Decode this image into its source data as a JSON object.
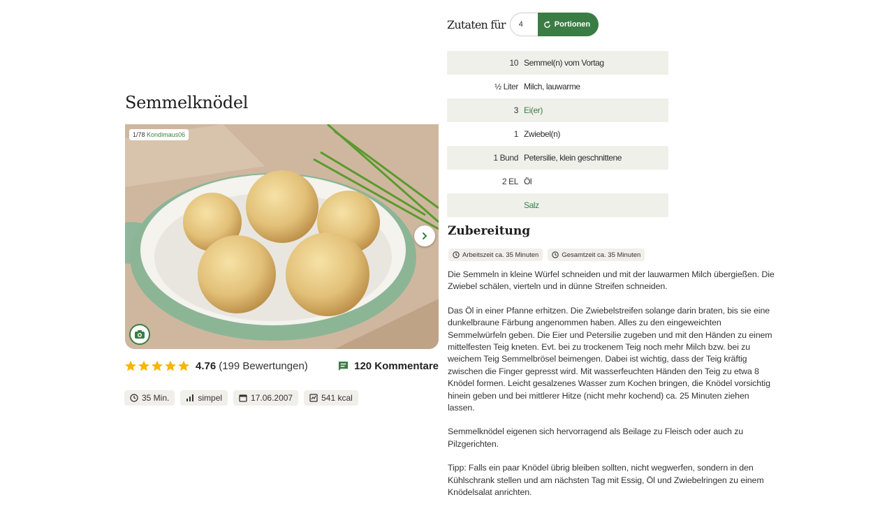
{
  "recipe": {
    "title": "Semmelknödel",
    "image_counter": "1/78",
    "image_author": "Kondimaus06",
    "rating_value": "4.76",
    "rating_count": "(199 Bewertungen)",
    "rating_stars": 5,
    "comments": "120 Kommentare",
    "meta": [
      {
        "icon": "clock-icon",
        "text": "35 Min."
      },
      {
        "icon": "difficulty-icon",
        "text": "simpel"
      },
      {
        "icon": "calendar-icon",
        "text": "17.06.2007"
      },
      {
        "icon": "nutrition-icon",
        "text": "541 kcal"
      }
    ]
  },
  "ingredients": {
    "label": "Zutaten für",
    "portions_value": "4",
    "portions_button": "Portionen",
    "items": [
      {
        "amount": "10",
        "name": "Semmel(n) vom Vortag",
        "link": false
      },
      {
        "amount": "½ Liter",
        "name": "Milch, lauwarme",
        "link": false
      },
      {
        "amount": "3",
        "name": "Ei(er)",
        "link": true
      },
      {
        "amount": "1",
        "name": "Zwiebel(n)",
        "link": false
      },
      {
        "amount": "1 Bund",
        "name": "Petersilie, klein geschnittene",
        "link": false
      },
      {
        "amount": "2 EL",
        "name": "Öl",
        "link": false
      },
      {
        "amount": "",
        "name": "Salz",
        "link": true
      }
    ]
  },
  "preparation": {
    "title": "Zubereitung",
    "times": [
      {
        "icon": "clock-icon",
        "text": "Arbeitszeit ca. 35 Minuten"
      },
      {
        "icon": "clock-icon",
        "text": "Gesamtzeit ca. 35 Minuten"
      }
    ],
    "paragraphs": [
      "Die Semmeln in kleine Würfel schneiden und mit der lauwarmen Milch übergießen. Die Zwiebel schälen, vierteln und in dünne Streifen schneiden.",
      "Das Öl in einer Pfanne erhitzen. Die Zwiebelstreifen solange darin braten, bis sie eine dunkelbraune Färbung angenommen haben. Alles zu den eingeweichten Semmelwürfeln geben. Die Eier und Petersilie zugeben und mit den Händen zu einem mittelfesten Teig kneten. Evt. bei zu trockenem Teig noch mehr Milch bzw. bei zu weichem Teig Semmelbrösel beimengen. Dabei ist wichtig, dass der Teig kräftig zwischen die Finger gepresst wird. Mit wasserfeuchten Händen den Teig zu etwa 8 Knödel formen. Leicht gesalzenes Wasser zum Kochen bringen, die Knödel vorsichtig hinein geben und bei mittlerer Hitze (nicht mehr kochend) ca. 25 Minuten ziehen lassen.",
      "Semmelknödel eigenen sich hervorragend als Beilage zu Fleisch oder auch zu Pilzgerichten.",
      "Tipp: Falls ein paar Knödel übrig bleiben sollten, nicht wegwerfen, sondern in den Kühlschrank stellen und am nächsten Tag mit Essig, Öl und Zwiebelringen zu einem Knödelsalat anrichten."
    ]
  },
  "colors": {
    "brand_green": "#3a7d44",
    "star": "#f5b500",
    "chip_bg": "#f0efe9"
  }
}
